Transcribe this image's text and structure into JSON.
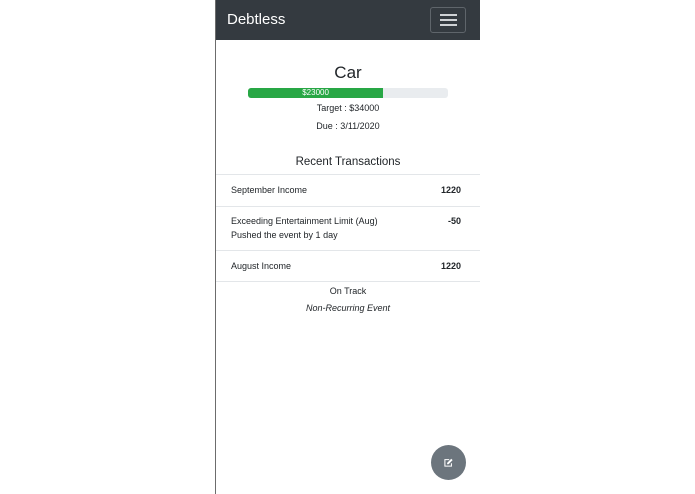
{
  "app": {
    "brand": "Debtless"
  },
  "goal": {
    "title": "Car",
    "progress_label": "$23000",
    "progress_fraction": 0.676,
    "target": "Target : $34000",
    "due": "Due : 3/11/2020"
  },
  "transactions": {
    "heading": "Recent Transactions",
    "items": [
      {
        "name": "September Income",
        "sub": "",
        "amount": "1220"
      },
      {
        "name": "Exceeding Entertainment Limit (Aug)",
        "sub": "Pushed the event by 1 day",
        "amount": "-50"
      },
      {
        "name": "August Income",
        "sub": "",
        "amount": "1220"
      }
    ]
  },
  "footer": {
    "status": "On Track",
    "recurrence": "Non-Recurring Event"
  },
  "colors": {
    "navbar": "#343a40",
    "progress_fill": "#28a745",
    "progress_track": "#e9ecef",
    "fab": "#6c757d"
  },
  "icons": {
    "menu": "hamburger-icon",
    "fab": "edit-icon"
  }
}
